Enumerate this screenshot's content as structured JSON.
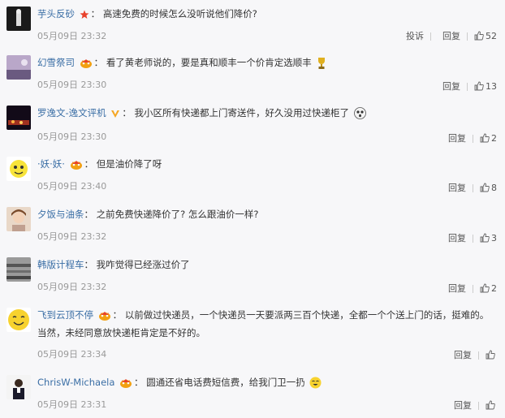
{
  "labels": {
    "report": "投诉",
    "reply": "回复"
  },
  "comments": [
    {
      "user": "芋头反砂",
      "content": "高速免费的时候怎么没听说他们降价?",
      "time": "05月09日 23:32",
      "likes": "52",
      "report": true
    },
    {
      "user": "幻雪祭司",
      "content": "看了黄老师说的，要是真和顺丰一个价肯定选顺丰",
      "time": "05月09日 23:30",
      "likes": "13"
    },
    {
      "user": "罗逸文-逸文评机",
      "content": "我小区所有快递都上门寄送件，好久没用过快递柜了",
      "time": "05月09日 23:30",
      "likes": "2"
    },
    {
      "user": "·妖·妖·",
      "content": "但是油价降了呀",
      "time": "05月09日 23:40",
      "likes": "8"
    },
    {
      "user": "夕饭与油条",
      "content": "之前免费快递降价了? 怎么跟油价一样?",
      "time": "05月09日 23:32",
      "likes": "3"
    },
    {
      "user": "韩版计程车",
      "content": "我咋觉得已经涨过价了",
      "time": "05月09日 23:32",
      "likes": "2"
    },
    {
      "user": "飞到云顶不停",
      "content": "以前做过快递员，一个快递员一天要派两三百个快递，全都一个个送上门的话，挺难的。",
      "content2": "当然，未经同意放快递柜肯定是不好的。",
      "time": "05月09日 23:34",
      "likes": ""
    },
    {
      "user": "ChrisW-Michaela",
      "content": "圆通还省电话费短信费，给我门卫一扔",
      "time": "05月09日 23:31",
      "likes": ""
    }
  ]
}
